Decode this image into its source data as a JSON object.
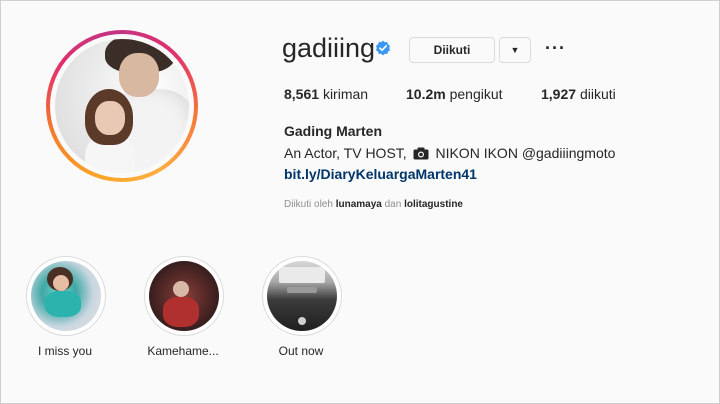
{
  "profile": {
    "username": "gadiiing",
    "verified_icon": "verified-badge-icon",
    "full_name": "Gading Marten",
    "bio_before_icon": "An Actor, TV HOST,",
    "bio_icon": "camera-icon",
    "bio_after_icon": "NIKON IKON @gadiiingmoto",
    "link": "bit.ly/DiaryKeluargaMarten41",
    "accent_ring_colors": [
      "#f9a526",
      "#e1306c",
      "#c13584"
    ],
    "link_color": "#003569",
    "verified_color": "#3897f0"
  },
  "actions": {
    "follow_label": "Diikuti",
    "dropdown_icon": "caret-down-icon",
    "more_label": "···"
  },
  "stats": {
    "posts_count": "8,561",
    "posts_label": "kiriman",
    "followers_count": "10.2m",
    "followers_label": "pengikut",
    "following_count": "1,927",
    "following_label": "diikuti"
  },
  "followed_by": {
    "prefix": "Diikuti oleh",
    "user1": "lunamaya",
    "joiner": "dan",
    "user2": "lolitagustine"
  },
  "highlights": [
    {
      "label": "I miss you"
    },
    {
      "label": "Kamehame..."
    },
    {
      "label": "Out now"
    }
  ]
}
